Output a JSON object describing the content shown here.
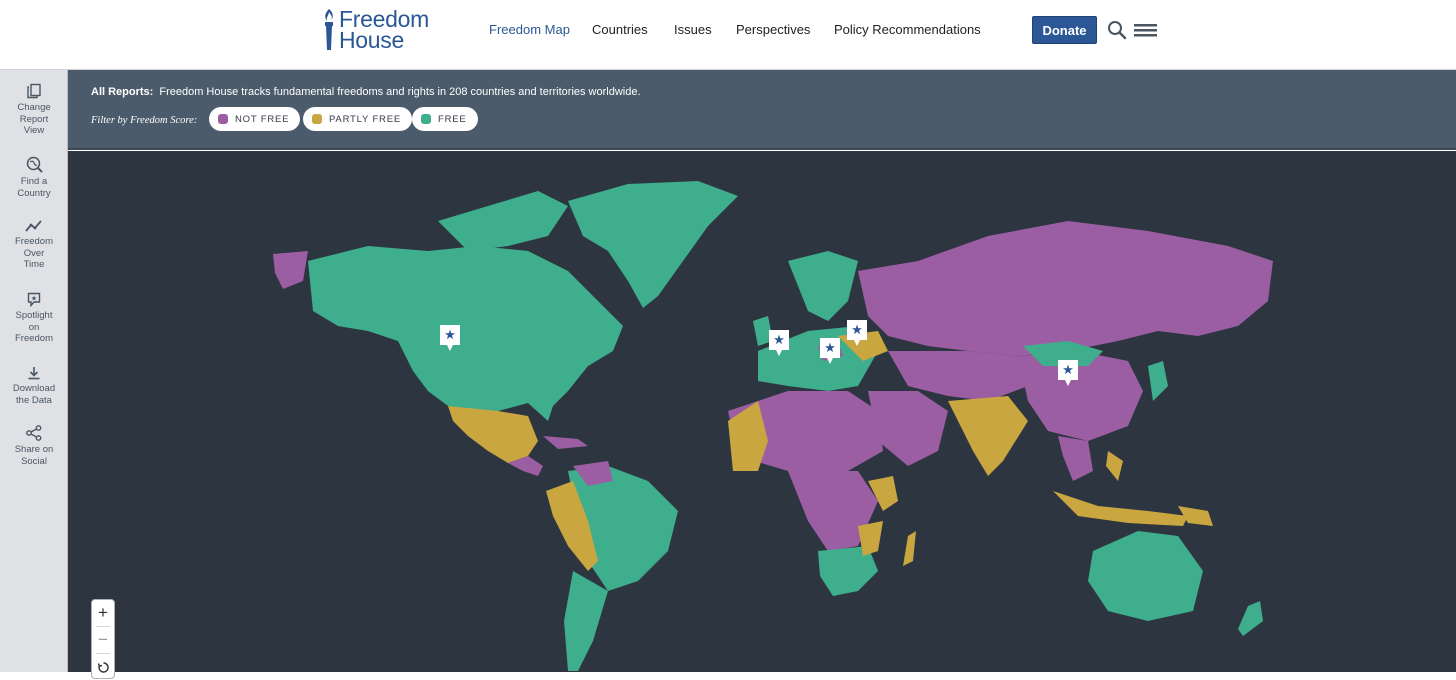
{
  "brand": {
    "line1": "Freedom",
    "line2": "House"
  },
  "nav": [
    {
      "label": "Freedom Map",
      "active": true
    },
    {
      "label": "Countries",
      "active": false
    },
    {
      "label": "Issues",
      "active": false
    },
    {
      "label": "Perspectives",
      "active": false
    },
    {
      "label": "Policy Recommendations",
      "active": false
    }
  ],
  "header": {
    "donate_label": "Donate",
    "search_icon": "search-icon",
    "menu_icon": "hamburger-menu-icon"
  },
  "sidebar": [
    {
      "label": "Change Report View",
      "icon": "copy-icon"
    },
    {
      "label": "Find a Country",
      "icon": "globe-search-icon"
    },
    {
      "label": "Freedom Over Time",
      "icon": "trend-line-icon"
    },
    {
      "label": "Spotlight on Freedom",
      "icon": "spotlight-icon"
    },
    {
      "label": "Download the Data",
      "icon": "download-icon"
    },
    {
      "label": "Share on Social",
      "icon": "share-icon"
    }
  ],
  "reports": {
    "label": "All Reports:",
    "text": "Freedom House tracks fundamental freedoms and rights in 208 countries and territories worldwide."
  },
  "filter": {
    "label": "Filter by Freedom Score:",
    "options": [
      {
        "label": "NOT FREE",
        "color": "#9b5ea3"
      },
      {
        "label": "PARTLY FREE",
        "color": "#c9a640"
      },
      {
        "label": "FREE",
        "color": "#3fae8c"
      }
    ]
  },
  "map": {
    "colors": {
      "not_free": "#9b5ea3",
      "partly_free": "#c9a640",
      "free": "#3fae8c",
      "ocean": "#2d3640",
      "marker": "#ffffff",
      "marker_star": "#2b5796"
    },
    "markers": [
      "spotlight-marker-north-america",
      "spotlight-marker-western-europe",
      "spotlight-marker-central-europe",
      "spotlight-marker-eastern-europe",
      "spotlight-marker-east-asia"
    ]
  },
  "zoom": {
    "in": "+",
    "out": "−",
    "reset_icon": "reset-icon"
  }
}
